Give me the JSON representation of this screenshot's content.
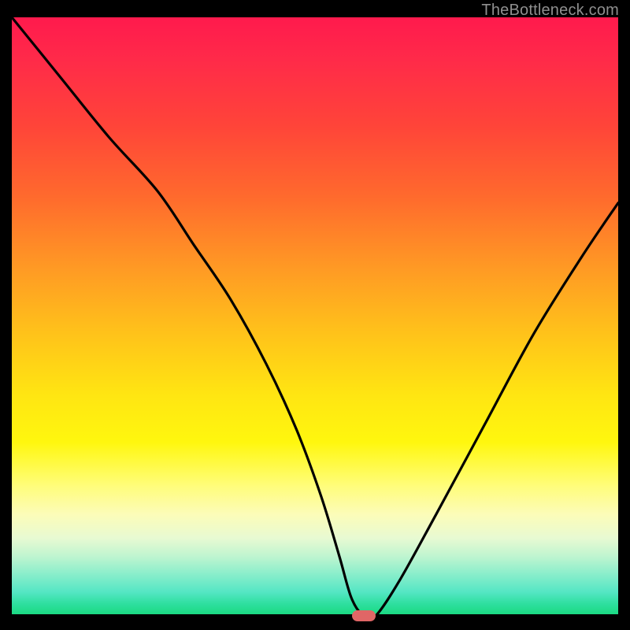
{
  "watermark": "TheBottleneck.com",
  "colors": {
    "frame": "#000000",
    "curve": "#000000",
    "marker": "#e06666"
  },
  "chart_data": {
    "type": "line",
    "title": "",
    "xlabel": "",
    "ylabel": "",
    "xlim": [
      0,
      100
    ],
    "ylim": [
      0,
      100
    ],
    "grid": false,
    "legend": false,
    "marker_x": 58,
    "series": [
      {
        "name": "bottleneck-curve",
        "x": [
          0,
          8,
          16,
          24,
          30,
          36,
          42,
          47,
          51,
          54,
          56,
          58,
          60,
          64,
          70,
          78,
          86,
          94,
          100
        ],
        "values": [
          100,
          90,
          80,
          71,
          62,
          53,
          42,
          31,
          20,
          10,
          3,
          0,
          0,
          6,
          17,
          32,
          47,
          60,
          69
        ]
      }
    ]
  }
}
